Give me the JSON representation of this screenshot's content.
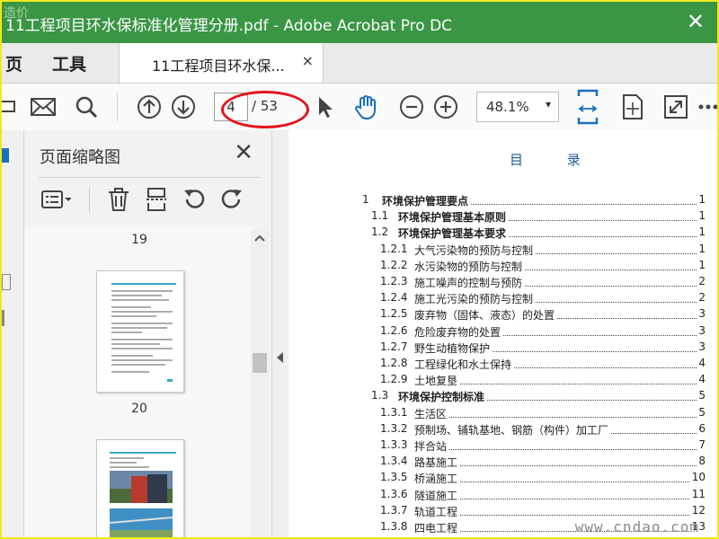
{
  "window": {
    "title": "11工程项目环水保标准化管理分册.pdf - Adobe Acrobat Pro DC",
    "close_glyph": "✕",
    "corner_watermark": "造价"
  },
  "menu": {
    "item1": "页",
    "item2": "工具"
  },
  "doc_tab": {
    "label": "11工程项目环水保...",
    "close": "×"
  },
  "toolbar": {
    "page_current": "4",
    "page_total": "/ 53",
    "zoom": "48.1%",
    "zoom_caret": "▾"
  },
  "colors": {
    "title_green": "#3a9645",
    "accent_blue": "#1a6fbf",
    "highlight_red": "#e3131b",
    "border_yellow": "#f2e81b"
  },
  "thumb_panel": {
    "title": "页面缩略图",
    "close": "✕",
    "pages": [
      {
        "number": "19"
      },
      {
        "number": "20"
      }
    ]
  },
  "document": {
    "toc_title": "目 录",
    "toc": [
      {
        "num": "1",
        "text": "环境保护管理要点",
        "page": "1",
        "level": 1
      },
      {
        "num": "1.1",
        "text": "环境保护管理基本原则",
        "page": "1",
        "level": 2
      },
      {
        "num": "1.2",
        "text": "环境保护管理基本要求",
        "page": "1",
        "level": 2
      },
      {
        "num": "1.2.1",
        "text": "大气污染物的预防与控制",
        "page": "1",
        "level": 3
      },
      {
        "num": "1.2.2",
        "text": "水污染物的预防与控制",
        "page": "1",
        "level": 3
      },
      {
        "num": "1.2.3",
        "text": "施工噪声的控制与预防",
        "page": "2",
        "level": 3
      },
      {
        "num": "1.2.4",
        "text": "施工光污染的预防与控制",
        "page": "2",
        "level": 3
      },
      {
        "num": "1.2.5",
        "text": "废弃物（固体、液态）的处置",
        "page": "3",
        "level": 3
      },
      {
        "num": "1.2.6",
        "text": "危险废弃物的处置",
        "page": "3",
        "level": 3
      },
      {
        "num": "1.2.7",
        "text": "野生动植物保护",
        "page": "3",
        "level": 3
      },
      {
        "num": "1.2.8",
        "text": "工程绿化和水土保持",
        "page": "4",
        "level": 3
      },
      {
        "num": "1.2.9",
        "text": "土地复垦",
        "page": "4",
        "level": 3
      },
      {
        "num": "1.3",
        "text": "环境保护控制标准",
        "page": "5",
        "level": 2
      },
      {
        "num": "1.3.1",
        "text": "生活区",
        "page": "5",
        "level": 3
      },
      {
        "num": "1.3.2",
        "text": "预制场、铺轨基地、钢筋（构件）加工厂",
        "page": "6",
        "level": 3
      },
      {
        "num": "1.3.3",
        "text": "拌合站",
        "page": "7",
        "level": 3
      },
      {
        "num": "1.3.4",
        "text": "路基施工",
        "page": "8",
        "level": 3
      },
      {
        "num": "1.3.5",
        "text": "桥涵施工",
        "page": "10",
        "level": 3
      },
      {
        "num": "1.3.6",
        "text": "隧道施工",
        "page": "11",
        "level": 3
      },
      {
        "num": "1.3.7",
        "text": "轨道工程",
        "page": "12",
        "level": 3
      },
      {
        "num": "1.3.8",
        "text": "四电工程",
        "page": "13",
        "level": 3
      }
    ]
  },
  "watermark": "www.cndao.com",
  "icons": {
    "toolbar": [
      "mail-icon",
      "search-icon",
      "page-up-icon",
      "page-down-icon",
      "select-cursor-icon",
      "hand-icon",
      "zoom-out-icon",
      "zoom-in-icon",
      "fit-page-icon",
      "rotate-page-icon",
      "fullscreen-icon",
      "more-icon"
    ],
    "panel": [
      "thumbnail-options-icon",
      "delete-icon",
      "extract-icon",
      "rotate-left-icon",
      "rotate-right-icon"
    ]
  }
}
